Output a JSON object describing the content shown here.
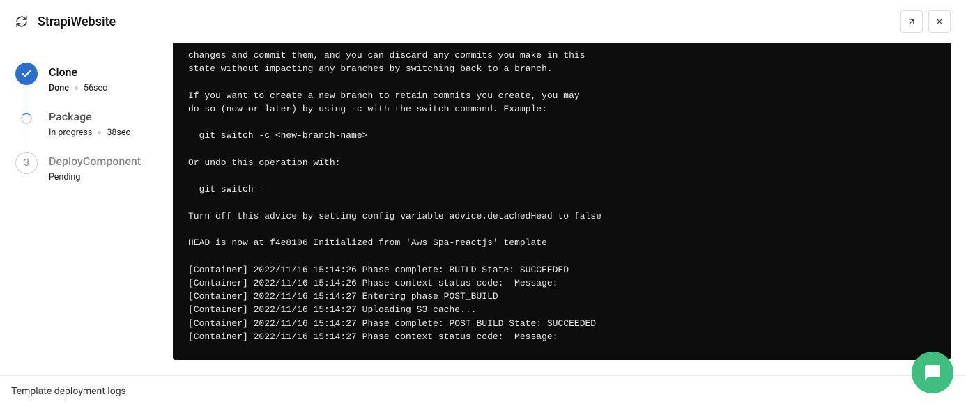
{
  "header": {
    "title": "StrapiWebsite"
  },
  "steps": [
    {
      "title": "Clone",
      "status": "Done",
      "time": "56sec",
      "badge": "check",
      "style": "done"
    },
    {
      "title": "Package",
      "status": "In progress",
      "time": "38sec",
      "badge": "spinner",
      "style": "progress"
    },
    {
      "title": "DeployComponent",
      "status": "Pending",
      "time": "",
      "badge": "3",
      "style": "pending"
    }
  ],
  "console_lines": [
    "changes and commit them, and you can discard any commits you make in this",
    "state without impacting any branches by switching back to a branch.",
    "",
    "If you want to create a new branch to retain commits you create, you may",
    "do so (now or later) by using -c with the switch command. Example:",
    "",
    "  git switch -c <new-branch-name>",
    "",
    "Or undo this operation with:",
    "",
    "  git switch -",
    "",
    "Turn off this advice by setting config variable advice.detachedHead to false",
    "",
    "HEAD is now at f4e8106 Initialized from 'Aws Spa-reactjs' template",
    "",
    "[Container] 2022/11/16 15:14:26 Phase complete: BUILD State: SUCCEEDED",
    "[Container] 2022/11/16 15:14:26 Phase context status code:  Message: ",
    "[Container] 2022/11/16 15:14:27 Entering phase POST_BUILD",
    "[Container] 2022/11/16 15:14:27 Uploading S3 cache...",
    "[Container] 2022/11/16 15:14:27 Phase complete: POST_BUILD State: SUCCEEDED",
    "[Container] 2022/11/16 15:14:27 Phase context status code:  Message: "
  ],
  "footer": {
    "label": "Template deployment logs"
  }
}
